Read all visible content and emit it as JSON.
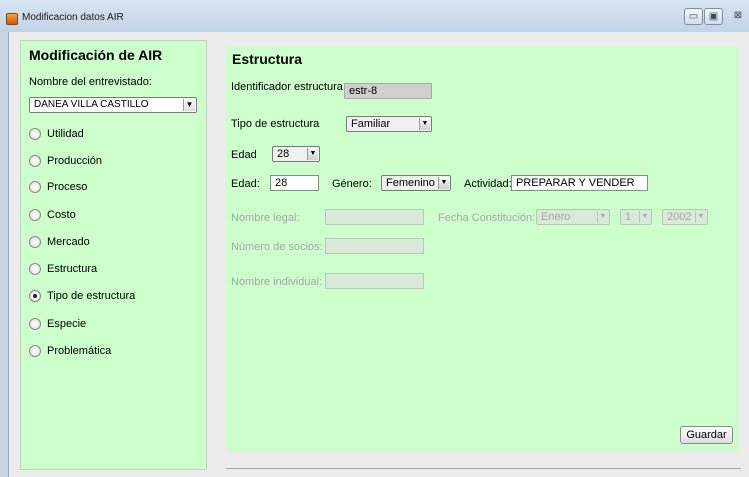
{
  "window": {
    "title": "Modificacion datos  AIR",
    "buttons": {
      "minimize": "▭",
      "maximize": "▣",
      "close": "⊠"
    }
  },
  "sidebar": {
    "title": "Modificación de AIR",
    "interviewee_label": "Nombre del entrevistado:",
    "interviewee_value": "DANEA VILLA CASTILLO",
    "options": [
      {
        "label": "Utilidad",
        "checked": false
      },
      {
        "label": "Producción",
        "checked": false
      },
      {
        "label": "Proceso",
        "checked": false
      },
      {
        "label": "Costo",
        "checked": false
      },
      {
        "label": "Mercado",
        "checked": false
      },
      {
        "label": "Estructura",
        "checked": false
      },
      {
        "label": "Tipo de estructura",
        "checked": true
      },
      {
        "label": "Especie",
        "checked": false
      },
      {
        "label": "Problemática",
        "checked": false
      }
    ]
  },
  "main": {
    "title": "Estructura",
    "id_label": "Identificador estructura",
    "id_value": "estr-8",
    "type_label": "Tipo de estructura",
    "type_value": "Familiar",
    "age_label_1": "Edad",
    "age_value_1": "28",
    "age_label_2": "Edad:",
    "age_value_2": "28",
    "gender_label": "Género:",
    "gender_value": "Femenino",
    "activity_label": "Actividad:",
    "activity_value": "PREPARAR Y VENDER",
    "legal_name_label": "Nombre legal:",
    "legal_name_value": "",
    "constitution_label": "Fecha Constitución:",
    "constitution_month": "Enero",
    "constitution_day": "1",
    "constitution_year": "2002",
    "partners_label": "Número de socios:",
    "partners_value": "",
    "individual_name_label": "Nombre individual:",
    "individual_name_value": "",
    "save_label": "Guardar"
  },
  "icons": {
    "dropdown": "▼",
    "app": "java-cup-icon"
  },
  "colors": {
    "panel_bg": "#ccffcc",
    "titlebar": "#d3e0f0",
    "disabled_text": "#a6a6a6"
  }
}
